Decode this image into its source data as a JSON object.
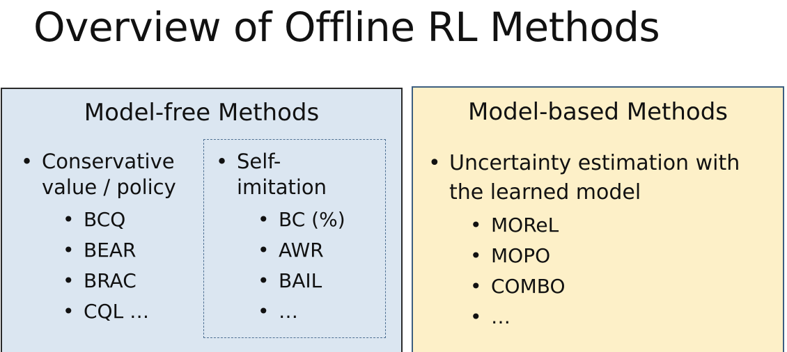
{
  "slide": {
    "title": "Overview of Offline RL Methods"
  },
  "model_free": {
    "title": "Model-free Methods",
    "conservative": {
      "line1": "Conservative",
      "line2": "value / policy",
      "items": [
        "BCQ",
        "BEAR",
        "BRAC",
        "CQL …"
      ]
    },
    "self_imitation": {
      "line1": "Self-",
      "line2": "imitation",
      "items": [
        "BC (%)",
        "AWR",
        "BAIL",
        "…"
      ]
    }
  },
  "model_based": {
    "title": "Model-based Methods",
    "uncertainty": {
      "line1": "Uncertainty estimation with",
      "line2": "the learned model",
      "items": [
        "MOReL",
        "MOPO",
        "COMBO",
        "…"
      ]
    }
  },
  "colors": {
    "model_free_bg": "#dbe6f1",
    "model_based_bg": "#fdf0c8",
    "dashed_border": "#4d6f92"
  }
}
